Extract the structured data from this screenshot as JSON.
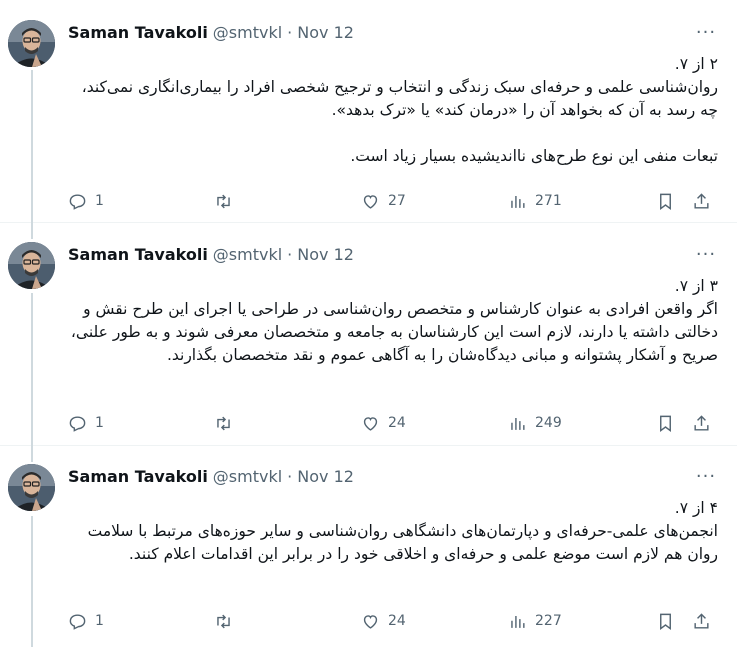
{
  "tweets": [
    {
      "name": "Saman Tavakoli",
      "handle": "@smtvkl",
      "dot": "·",
      "date": "Nov 12",
      "more": "···",
      "paragraphs": [
        "۲ از ۷.\nروان‌شناسی علمی و حرفه‌ای سبک زندگی و انتخاب و ترجیح شخصی افراد را بیماری‌انگاری نمی‌کند، چه رسد به آن که بخواهد آن را «درمان کند» یا «ترک بدهد».",
        "تبعات منفی این نوع طرح‌های نااندیشیده بسیار زیاد است."
      ],
      "replies": "1",
      "retweets": "",
      "likes": "27",
      "views": "271"
    },
    {
      "name": "Saman Tavakoli",
      "handle": "@smtvkl",
      "dot": "·",
      "date": "Nov 12",
      "more": "···",
      "paragraphs": [
        "۳ از ۷.\nاگر واقعن افرادی به عنوان کارشناس و متخصص روان‌شناسی در طراحی یا اجرای این طرح نقش و دخالتی داشته یا دارند، لازم است این کارشناسان به جامعه و متخصصان معرفی شوند و به طور علنی، صریح و آشکار پشتوانه و مبانی دیدگاه‌شان را به آگاهی عموم و نقد متخصصان بگذارند."
      ],
      "replies": "1",
      "retweets": "",
      "likes": "24",
      "views": "249"
    },
    {
      "name": "Saman Tavakoli",
      "handle": "@smtvkl",
      "dot": "·",
      "date": "Nov 12",
      "more": "···",
      "paragraphs": [
        "۴ از ۷.\nانجمن‌های علمی-حرفه‌ای و دپارتمان‌های دانشگاهی روان‌شناسی و سایر حوزه‌های مرتبط با سلامت روان هم لازم است موضع علمی و حرفه‌ای و اخلاقی خود را در برابر این اقدامات اعلام کنند."
      ],
      "replies": "1",
      "retweets": "",
      "likes": "24",
      "views": "227"
    }
  ],
  "icons": {
    "reply": "reply-icon",
    "retweet": "retweet-icon",
    "like": "heart-icon",
    "views": "views-icon",
    "bookmark": "bookmark-icon",
    "share": "share-icon"
  },
  "colors": {
    "text": "#0f1419",
    "secondary": "#536471",
    "thread_line": "#cfd9de",
    "divider": "#eff3f4"
  }
}
